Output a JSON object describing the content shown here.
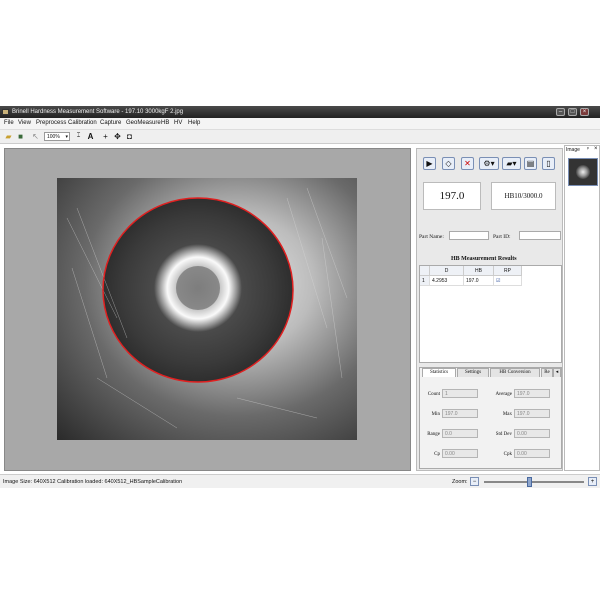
{
  "window": {
    "title": "Brinell Hardness Measurement Software - 197.10 3000kgF 2.jpg"
  },
  "menu": [
    "File",
    "View",
    "Preprocess",
    "Calibration",
    "Capture",
    "GeoMeasure",
    "HB",
    "HV",
    "Help"
  ],
  "toolbar": {
    "zoom_value": "100%",
    "text_tool_label": "A"
  },
  "results": {
    "hb_value": "197.0",
    "hb_scale": "HB10/3000.0",
    "part_name_label": "Part Name:",
    "part_id_label": "Part ID:",
    "table_title": "HB Measurement Results",
    "columns": [
      "D",
      "HB",
      "RP"
    ],
    "rows": [
      {
        "index": "1",
        "d": "4.2953",
        "hb": "197.0",
        "rp": "☑"
      }
    ]
  },
  "stats": {
    "tabs": [
      "Statistics",
      "Settings",
      "HB Conversion",
      "Re"
    ],
    "count_label": "Count",
    "count": "1",
    "average_label": "Average",
    "average": "197.0",
    "min_label": "Min",
    "min": "197.0",
    "max_label": "Max",
    "max": "197.0",
    "range_label": "Range",
    "range": "0.0",
    "stddev_label": "Std Dev",
    "stddev": "0.00",
    "cp_label": "Cp",
    "cp": "0.00",
    "cpk_label": "Cpk",
    "cpk": "0.00"
  },
  "side_panel": {
    "title": "Image"
  },
  "status": {
    "text": "Image Size: 640X512  Calibration loaded: 640X512_HBSampleCalibration",
    "zoom_label": "Zoom:",
    "zoom_level": 0.45
  }
}
